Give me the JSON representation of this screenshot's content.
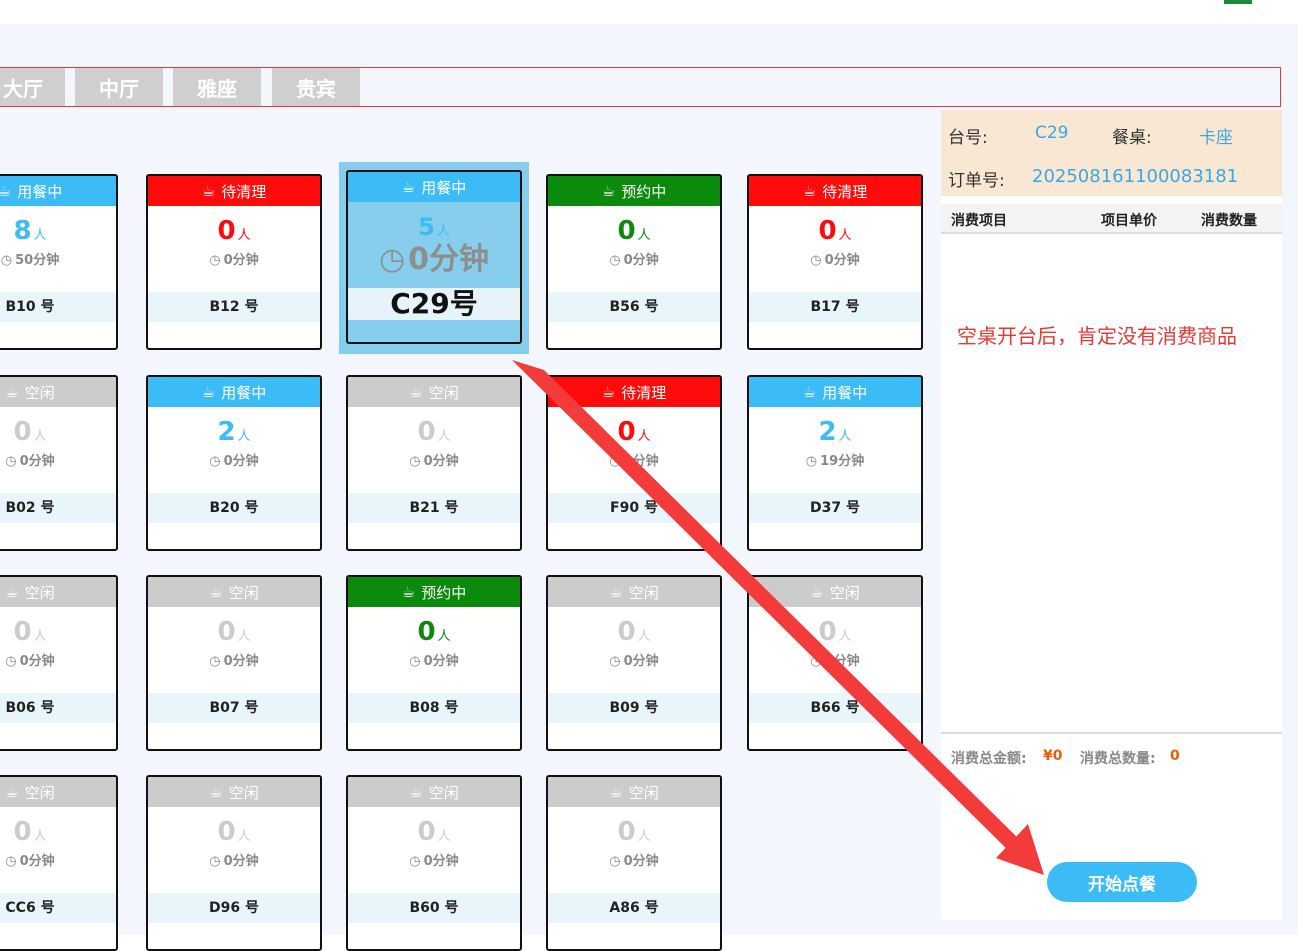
{
  "colors": {
    "dining": "#3bbcf6",
    "cleaning": "#ff0b0b",
    "reserved": "#0b8a0b",
    "idle": "#cccccc",
    "accent": "#3aa7e4",
    "arrow": "#f43b3b"
  },
  "tabs": [
    "大厅",
    "中厅",
    "雅座",
    "贵宾"
  ],
  "person_unit": "人",
  "tables": [
    {
      "status": "用餐中",
      "kind": "dining",
      "count": "8",
      "duration": "50分钟",
      "number": "B10 号"
    },
    {
      "status": "待清理",
      "kind": "cleaning",
      "count": "0",
      "duration": "0分钟",
      "number": "B12 号"
    },
    {
      "status": "用餐中",
      "kind": "dining",
      "count": "5",
      "duration": "0分钟",
      "number": "C29号"
    },
    {
      "status": "预约中",
      "kind": "reserved",
      "count": "0",
      "duration": "0分钟",
      "number": "B56 号"
    },
    {
      "status": "待清理",
      "kind": "cleaning",
      "count": "0",
      "duration": "0分钟",
      "number": "B17 号"
    },
    {
      "status": "空闲",
      "kind": "idle",
      "count": "0",
      "duration": "0分钟",
      "number": "B02 号"
    },
    {
      "status": "用餐中",
      "kind": "dining",
      "count": "2",
      "duration": "0分钟",
      "number": "B20 号"
    },
    {
      "status": "空闲",
      "kind": "idle",
      "count": "0",
      "duration": "0分钟",
      "number": "B21 号"
    },
    {
      "status": "待清理",
      "kind": "cleaning",
      "count": "0",
      "duration": "0分钟",
      "number": "F90 号"
    },
    {
      "status": "用餐中",
      "kind": "dining",
      "count": "2",
      "duration": "19分钟",
      "number": "D37 号"
    },
    {
      "status": "空闲",
      "kind": "idle",
      "count": "0",
      "duration": "0分钟",
      "number": "B06 号"
    },
    {
      "status": "空闲",
      "kind": "idle",
      "count": "0",
      "duration": "0分钟",
      "number": "B07 号"
    },
    {
      "status": "预约中",
      "kind": "reserved",
      "count": "0",
      "duration": "0分钟",
      "number": "B08 号"
    },
    {
      "status": "空闲",
      "kind": "idle",
      "count": "0",
      "duration": "0分钟",
      "number": "B09 号"
    },
    {
      "status": "空闲",
      "kind": "idle",
      "count": "0",
      "duration": "0分钟",
      "number": "B66 号"
    },
    {
      "status": "空闲",
      "kind": "idle",
      "count": "0",
      "duration": "0分钟",
      "number": "CC6 号"
    },
    {
      "status": "空闲",
      "kind": "idle",
      "count": "0",
      "duration": "0分钟",
      "number": "D96 号"
    },
    {
      "status": "空闲",
      "kind": "idle",
      "count": "0",
      "duration": "0分钟",
      "number": "B60 号"
    },
    {
      "status": "空闲",
      "kind": "idle",
      "count": "0",
      "duration": "0分钟",
      "number": "A86 号"
    }
  ],
  "panel": {
    "table_no_label": "台号:",
    "table_no": "C29",
    "table_type_label": "餐桌:",
    "table_type": "卡座",
    "order_label": "订单号:",
    "order_no": "202508161100083181",
    "col_item": "消费项目",
    "col_price": "项目单价",
    "col_qty": "消费数量",
    "empty_msg": "空桌开台后，肯定没有消费商品",
    "total_amount_label": "消费总金额:",
    "total_amount": "¥0",
    "total_qty_label": "消费总数量:",
    "total_qty": "0",
    "start_label": "开始点餐"
  }
}
